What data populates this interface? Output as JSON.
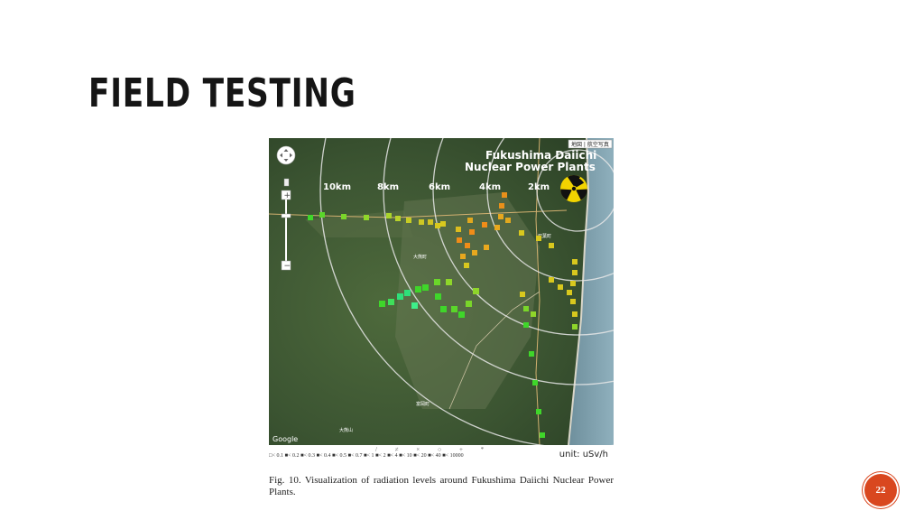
{
  "slide": {
    "title": "FIELD TESTING",
    "page_number": "22"
  },
  "map": {
    "title_line1": "Fukushima Daiichi",
    "title_line2": "Nuclear Power Plants",
    "ring_labels": [
      "10km",
      "8km",
      "6km",
      "4km",
      "2km"
    ],
    "place_labels": [
      "大熊町",
      "双葉町",
      "富岡町",
      "大熊山"
    ],
    "attribution": "Google",
    "map_type_buttons": "地図 | 航空写真",
    "icons": [
      "pan-control-icon",
      "zoom-in-icon",
      "zoom-out-icon",
      "radiation-trefoil-icon"
    ],
    "colors": {
      "terrain": "#3f5a35",
      "ring": "#e8e8e8",
      "hazard_yellow": "#f2d400",
      "marker_green": "#3fd62a",
      "marker_yellow": "#d8c81e",
      "marker_orange": "#f08c18"
    }
  },
  "legend": {
    "scale_text": "□< 0.1 ■< 0.2 ■< 0.3 ■< 0.4 ■< 0.5 ■< 0.7 ■< 1 ■< 2 ■< 4 ■< 10 ■< 20 ■< 40 ■< 10000",
    "symbols": "/ ≠ × ○ + *",
    "unit": "unit: uSv/h"
  },
  "caption": "Fig. 10.   Visualization of radiation levels around Fukushima Daiichi Nuclear Power Plants."
}
